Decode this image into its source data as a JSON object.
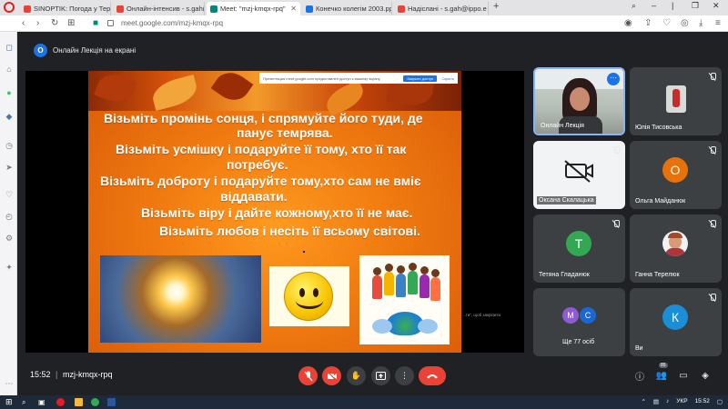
{
  "browser": {
    "tabs": [
      {
        "label": "SINOPTIK: Погода у Терн",
        "favicon_color": "#e94235",
        "active": false
      },
      {
        "label": "Онлайн-інтенсив - s.gah(",
        "favicon_color": "#ea4335",
        "active": false
      },
      {
        "label": "Meet: \"mzj-kmqx-rpq\"",
        "favicon_color": "#00897b",
        "active": true
      },
      {
        "label": "Конечко колегім 2003.ppt",
        "favicon_color": "#1a73e8",
        "active": false
      },
      {
        "label": "Надіслані - s.gah@ippo.e",
        "favicon_color": "#ea4335",
        "active": false
      }
    ],
    "url": "meet.google.com/mzj-kmqx-rpq"
  },
  "meet": {
    "presenter_avatar_letter": "О",
    "presentation_title": "Онлайн Лекція на екрані",
    "share_bar": {
      "text": "Презентация meet.google.com предоставлен доступ к вашему экрану",
      "stop_label": "Закрыть доступ",
      "hide_label": "Скрыть"
    },
    "slide_lines": [
      "Візьміть промінь сонця, і спрямуйте його туди, де",
      "панує темрява.",
      "Візьміть усмішку і подаруйте її тому, хто її так",
      "потребує.",
      "Візьміть доброту і подаруйте тому,хто сам не вміє",
      "віддавати.",
      "Візьміть віру і дайте кожному,хто її не має.",
      "Візьміть любов і несіть її всьому світові."
    ],
    "pin_hint": "...ти\", щоб закріпити",
    "participants": [
      {
        "name": "Онлайн Лекція",
        "type": "video",
        "muted": false
      },
      {
        "name": "Юлія Тисовська",
        "type": "video-small",
        "muted": true
      },
      {
        "name": "Оксана Скалацька",
        "type": "camera-off",
        "muted": true
      },
      {
        "name": "Ольга Майданюк",
        "type": "avatar",
        "letter": "О",
        "color": "#e8710a",
        "muted": true
      },
      {
        "name": "Тетяна Гладанюк",
        "type": "avatar",
        "letter": "Т",
        "color": "#33a852",
        "muted": true
      },
      {
        "name": "Ганна Терелюк",
        "type": "photo",
        "muted": true
      },
      {
        "name": "Ще 77 осіб",
        "type": "group",
        "letters": [
          "М",
          "С"
        ],
        "colors": [
          "#8e5bd3",
          "#1967d2"
        ],
        "muted": false
      },
      {
        "name": "Ви",
        "type": "avatar",
        "letter": "К",
        "color": "#1a8fd8",
        "muted": true
      }
    ],
    "time": "15:52",
    "separator": "|",
    "meeting_code": "mzj-kmqx-rpq",
    "participant_count": "85"
  },
  "taskbar": {
    "lang": "УКР",
    "clock": "15:52"
  }
}
